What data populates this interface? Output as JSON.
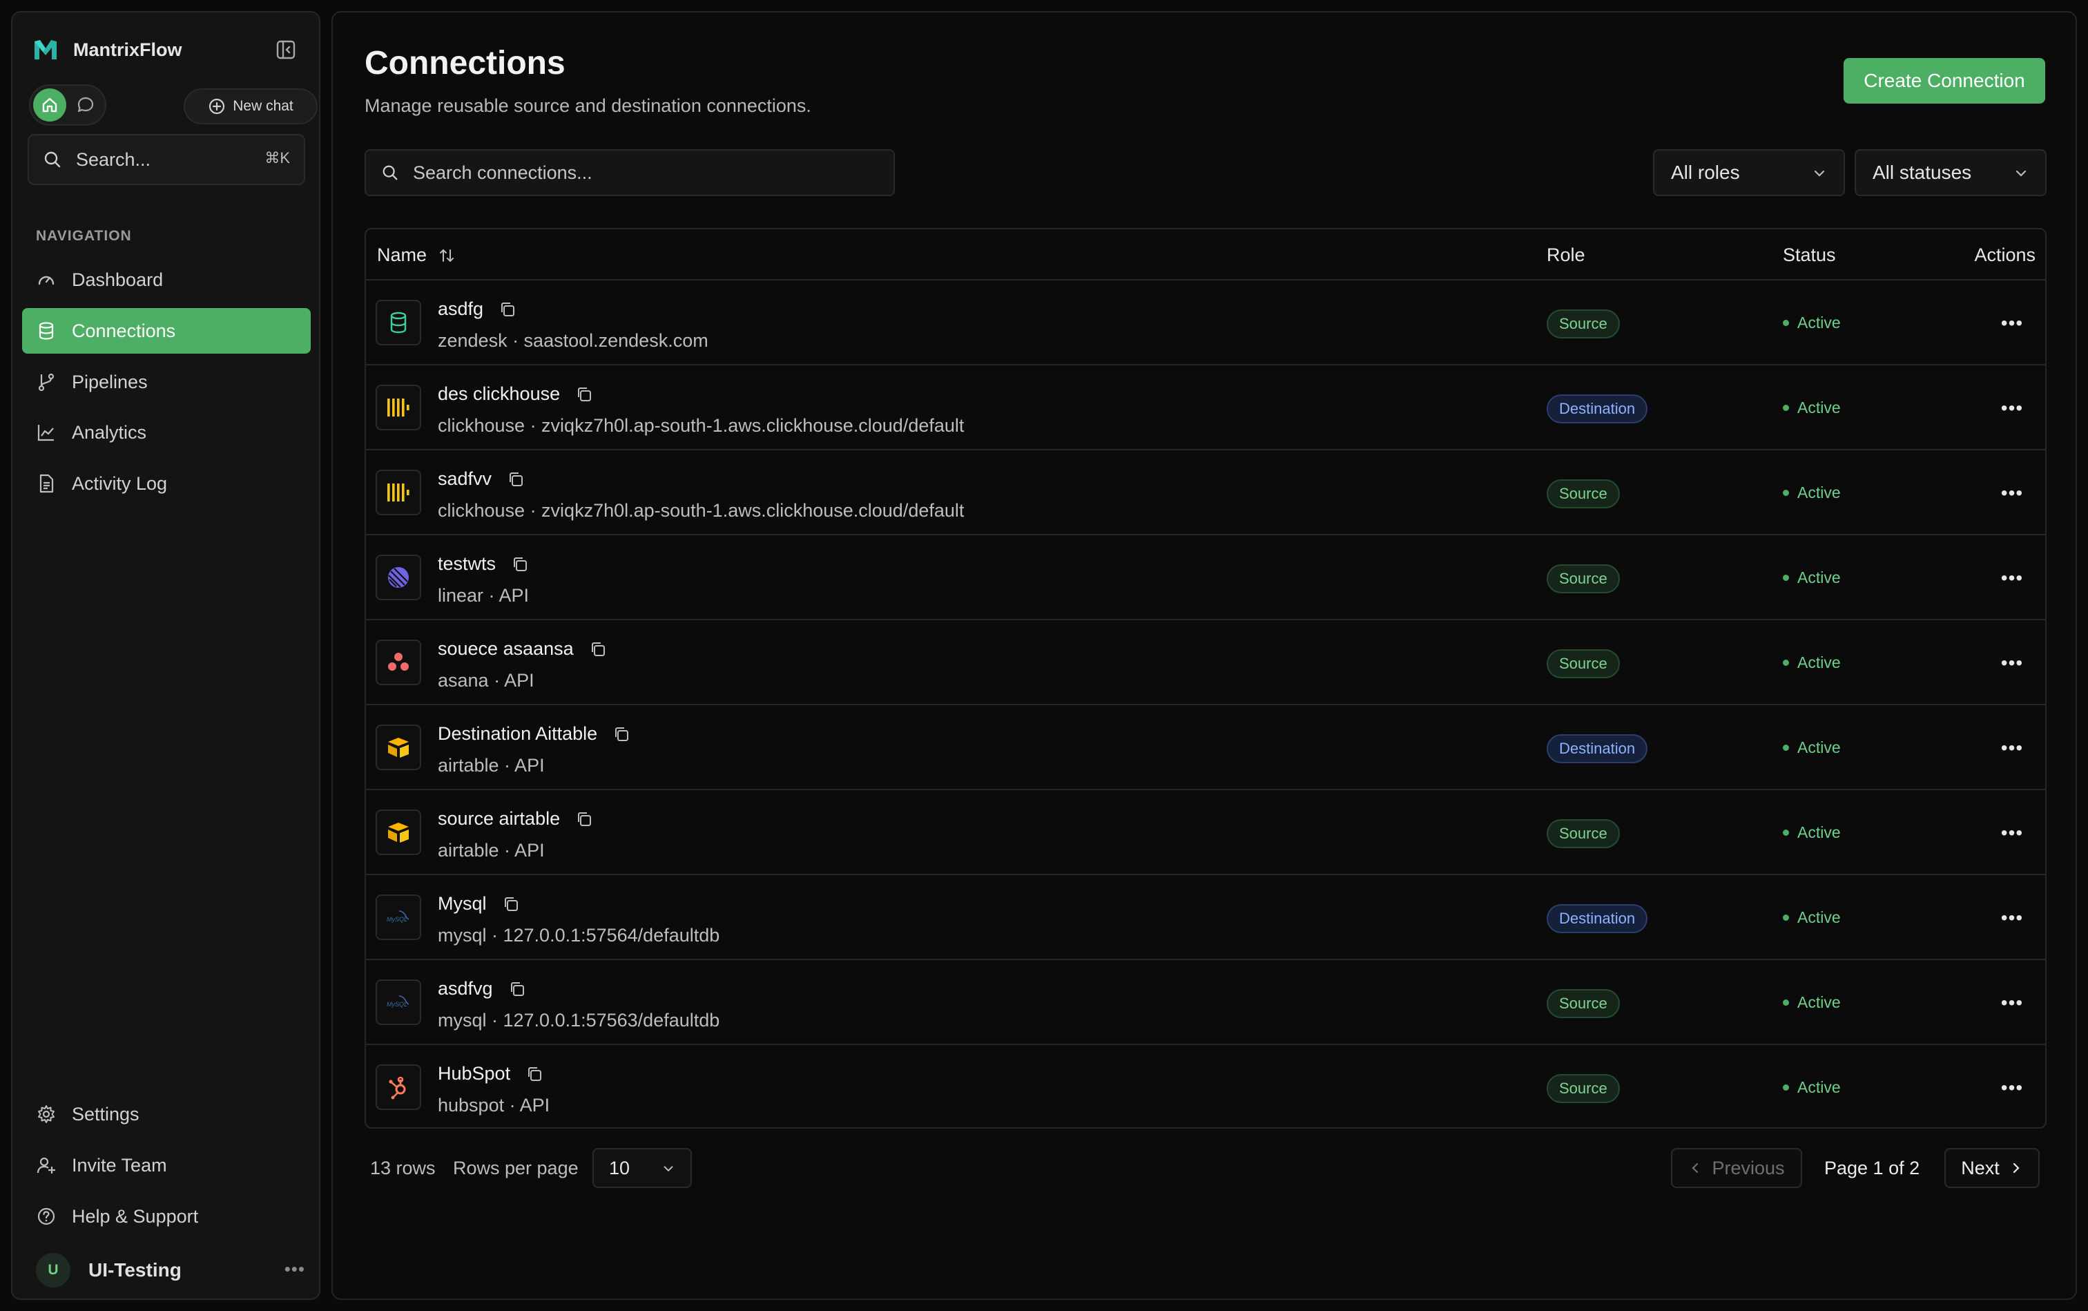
{
  "app": {
    "name": "MantrixFlow"
  },
  "sidebar": {
    "new_chat_label": "New chat",
    "search_placeholder": "Search...",
    "search_shortcut": "⌘K",
    "nav_heading": "NAVIGATION",
    "nav_items": [
      {
        "label": "Dashboard",
        "icon": "gauge-icon",
        "active": false
      },
      {
        "label": "Connections",
        "icon": "database-icon",
        "active": true
      },
      {
        "label": "Pipelines",
        "icon": "git-branch-icon",
        "active": false
      },
      {
        "label": "Analytics",
        "icon": "line-chart-icon",
        "active": false
      },
      {
        "label": "Activity Log",
        "icon": "file-text-icon",
        "active": false
      }
    ],
    "bottom_items": [
      {
        "label": "Settings",
        "icon": "gear-icon"
      },
      {
        "label": "Invite Team",
        "icon": "user-plus-icon"
      },
      {
        "label": "Help & Support",
        "icon": "help-circle-icon"
      }
    ],
    "user": {
      "initial": "U",
      "name": "UI-Testing"
    }
  },
  "page": {
    "title": "Connections",
    "subtitle": "Manage reusable source and destination connections.",
    "create_button": "Create Connection",
    "search_placeholder": "Search connections...",
    "role_filter": "All roles",
    "status_filter": "All statuses"
  },
  "table": {
    "columns": {
      "name": "Name",
      "role": "Role",
      "status": "Status",
      "actions": "Actions"
    },
    "rows": [
      {
        "name": "asdfg",
        "sub": "zendesk · saastool.zendesk.com",
        "role": "Source",
        "status": "Active",
        "icon": "zendesk-db-icon"
      },
      {
        "name": "des clickhouse",
        "sub": "clickhouse · zviqkz7h0l.ap-south-1.aws.clickhouse.cloud/default",
        "role": "Destination",
        "status": "Active",
        "icon": "clickhouse-icon"
      },
      {
        "name": "sadfvv",
        "sub": "clickhouse · zviqkz7h0l.ap-south-1.aws.clickhouse.cloud/default",
        "role": "Source",
        "status": "Active",
        "icon": "clickhouse-icon"
      },
      {
        "name": "testwts",
        "sub": "linear · API",
        "role": "Source",
        "status": "Active",
        "icon": "linear-icon"
      },
      {
        "name": "souece asaansa",
        "sub": "asana · API",
        "role": "Source",
        "status": "Active",
        "icon": "asana-icon"
      },
      {
        "name": "Destination Aittable",
        "sub": "airtable · API",
        "role": "Destination",
        "status": "Active",
        "icon": "airtable-icon"
      },
      {
        "name": "source airtable",
        "sub": "airtable · API",
        "role": "Source",
        "status": "Active",
        "icon": "airtable-icon"
      },
      {
        "name": "Mysql",
        "sub": "mysql · 127.0.0.1:57564/defaultdb",
        "role": "Destination",
        "status": "Active",
        "icon": "mysql-icon"
      },
      {
        "name": "asdfvg",
        "sub": "mysql · 127.0.0.1:57563/defaultdb",
        "role": "Source",
        "status": "Active",
        "icon": "mysql-icon"
      },
      {
        "name": "HubSpot",
        "sub": "hubspot · API",
        "role": "Source",
        "status": "Active",
        "icon": "hubspot-icon"
      }
    ]
  },
  "footer": {
    "row_count": "13 rows",
    "rows_per_page_label": "Rows per page",
    "rows_per_page_value": "10",
    "previous": "Previous",
    "page_info": "Page 1 of 2",
    "next": "Next"
  },
  "colors": {
    "accent": "#4caf63",
    "background": "#0a0a0a",
    "panel": "#141414"
  }
}
